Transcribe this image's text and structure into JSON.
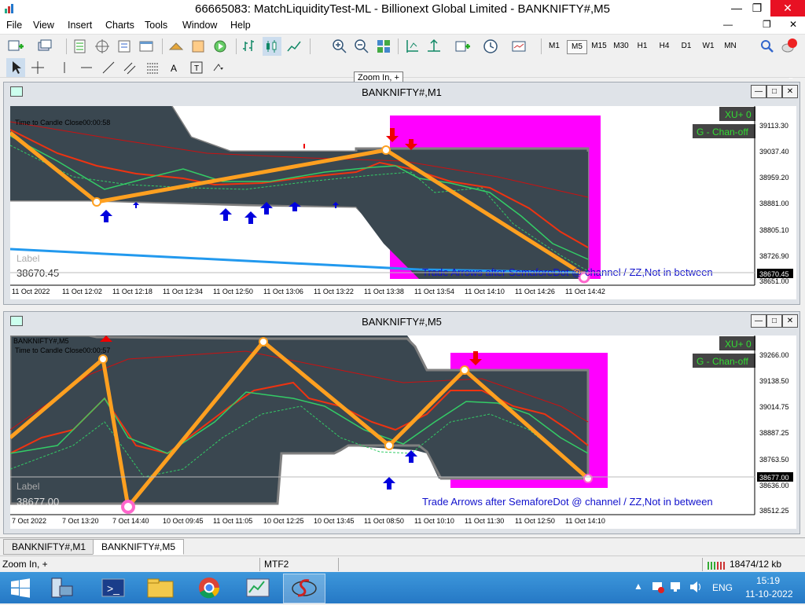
{
  "window": {
    "title": "66665083: MatchLiquidityTest-ML - Billionext Global Limited - BANKNIFTY#,M5"
  },
  "menu": [
    "File",
    "View",
    "Insert",
    "Charts",
    "Tools",
    "Window",
    "Help"
  ],
  "timeframes": [
    "M1",
    "M5",
    "M15",
    "M30",
    "H1",
    "H4",
    "D1",
    "W1",
    "MN"
  ],
  "selected_timeframe": "M5",
  "notification_count": "1",
  "tooltip": "Zoom In, +",
  "chart1": {
    "title": "BANKNIFTY#,M1",
    "candle_timer": "Time to Candle Close00:00:58",
    "badge_xu": "XU+ 0",
    "badge_chan": "G - Chan-off",
    "label": "Label",
    "label_value": "38670.45",
    "trade_text": "Trade Arrows after SemaforeDot @ channel / ZZ,Not in between",
    "price_ticks": [
      "39113.30",
      "39037.40",
      "38959.20",
      "38881.00",
      "38805.10",
      "38726.90",
      "38651.00"
    ],
    "current_price": "38670.45",
    "time_ticks": [
      "11 Oct 2022",
      "11 Oct 12:02",
      "11 Oct 12:18",
      "11 Oct 12:34",
      "11 Oct 12:50",
      "11 Oct 13:06",
      "11 Oct 13:22",
      "11 Oct 13:38",
      "11 Oct 13:54",
      "11 Oct 14:10",
      "11 Oct 14:26",
      "11 Oct 14:42"
    ]
  },
  "chart2": {
    "title": "BANKNIFTY#,M5",
    "symbol_label": "BANKNIFTY#,M5",
    "candle_timer": "Time to Candle Close00:00:57",
    "badge_xu": "XU+ 0",
    "badge_chan": "G - Chan-off",
    "label": "Label",
    "label_value": "38677.00",
    "trade_text": "Trade Arrows after SemaforeDot @ channel / ZZ,Not in between",
    "price_ticks": [
      "39266.00",
      "39138.50",
      "39014.75",
      "38887.25",
      "38763.50",
      "38636.00",
      "38512.25"
    ],
    "current_price": "38677.00",
    "time_ticks": [
      "7 Oct 2022",
      "7 Oct 13:20",
      "7 Oct 14:40",
      "10 Oct 09:45",
      "11 Oct 11:05",
      "10 Oct 12:25",
      "10 Oct 13:45",
      "11 Oct 08:50",
      "11 Oct 10:10",
      "11 Oct 11:30",
      "11 Oct 12:50",
      "11 Oct 14:10"
    ]
  },
  "tabs": [
    "BANKNIFTY#,M1",
    "BANKNIFTY#,M5"
  ],
  "active_tab": "BANKNIFTY#,M5",
  "status": {
    "hint": "Zoom In, +",
    "profile": "MTF2",
    "traffic": "18474/12 kb"
  },
  "taskbar": {
    "language": "ENG",
    "time": "15:19",
    "date": "11-10-2022"
  },
  "colors": {
    "channel_fill": "#3a4750",
    "zigzag": "#ffa020",
    "magenta_box": "#ff00ff",
    "arrow_up": "#0000dd",
    "arrow_down": "#ee0000",
    "badge_bg": "#444444",
    "badge_text": "#33dd33"
  }
}
